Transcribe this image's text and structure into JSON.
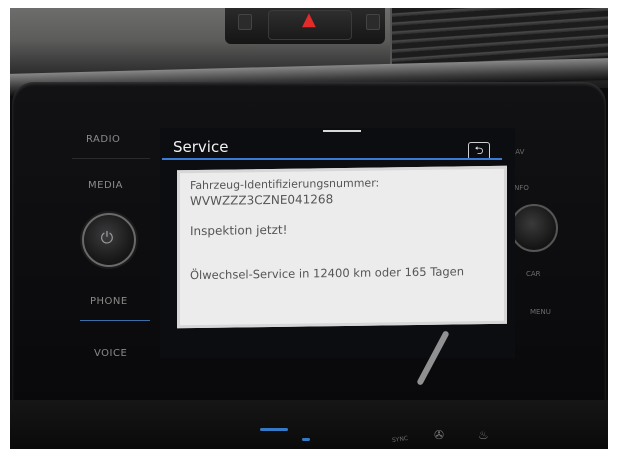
{
  "left_buttons": {
    "radio": "RADIO",
    "media": "MEDIA",
    "phone": "PHONE",
    "voice": "VOICE"
  },
  "right_buttons": {
    "nav": "NAV",
    "info": "INFO",
    "car": "CAR",
    "menu": "MENU"
  },
  "screen": {
    "title": "Service",
    "back_icon": "back-arrow-icon",
    "accent_color": "#3a7bd5"
  },
  "dialog": {
    "vin_label": "Fahrzeug-Identifizierungsnummer:",
    "vin_value": "WVWZZZ3CZNE041268",
    "inspection": "Inspektion jetzt!",
    "oil_service": "Ölwechsel-Service in 12400 km oder 165 Tagen"
  },
  "console": {
    "sync_label": "SYNC",
    "hazard_icon": "hazard-triangle-icon",
    "hazard_color": "#e52a2a"
  }
}
